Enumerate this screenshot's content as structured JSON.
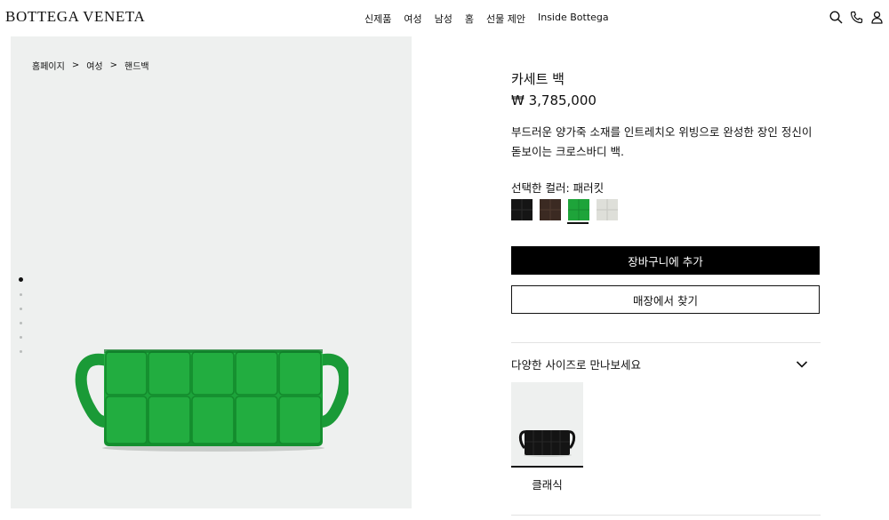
{
  "header": {
    "logo": "BOTTEGA VENETA",
    "nav": [
      "신제품",
      "여성",
      "남성",
      "홈",
      "선물 제안",
      "Inside Bottega"
    ],
    "icons": [
      "search-icon",
      "phone-icon",
      "account-icon"
    ]
  },
  "breadcrumb": [
    "홈페이지",
    "여성",
    "핸드백"
  ],
  "breadcrumb_separator": ">",
  "gallery": {
    "slide_count": 6,
    "active_slide": 1
  },
  "product": {
    "name": "카세트 백",
    "price": "₩ 3,785,000",
    "description": "부드러운 양가죽 소재를 인트레치오 위빙으로 완성한 장인 정신이 돋보이는 크로스바디 백.",
    "color_label": "선택한 컬러: 패러킷",
    "colors": [
      {
        "name": "black",
        "hex": "#151515"
      },
      {
        "name": "fondant",
        "hex": "#3b2a22"
      },
      {
        "name": "parakeet",
        "hex": "#1ea43a"
      },
      {
        "name": "white",
        "hex": "#dedfd9"
      }
    ],
    "selected_color_index": 2,
    "add_to_cart": "장바구니에 추가",
    "find_in_store": "매장에서 찾기"
  },
  "sizes": {
    "title": "다양한 사이즈로 만나보세요",
    "items": [
      {
        "label": "클래식"
      }
    ]
  },
  "colors": {
    "bag_green": "#1fa43b",
    "panel_bg": "#eef0ef",
    "button_bg": "#000000"
  }
}
